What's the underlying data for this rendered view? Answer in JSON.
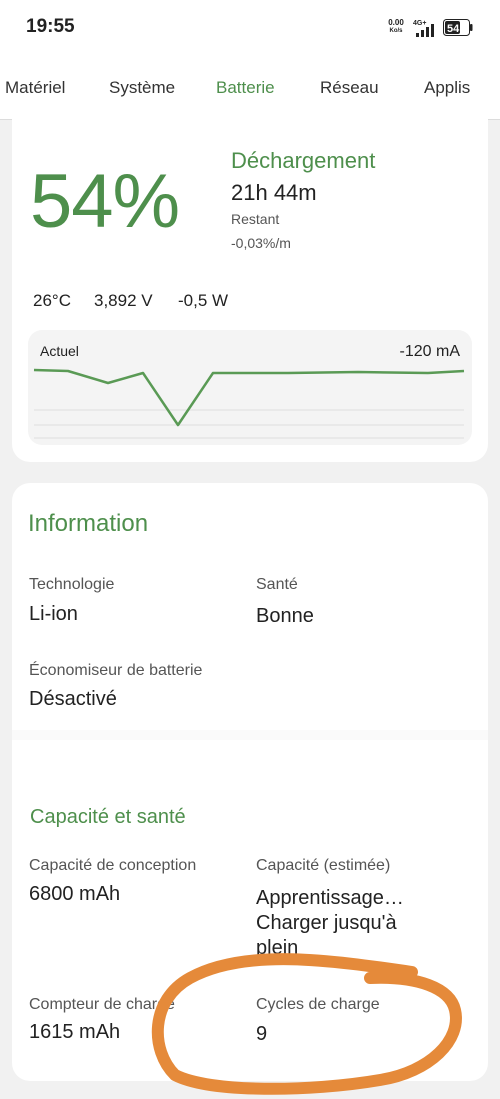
{
  "status_bar": {
    "time": "19:55",
    "net_speed_value": "0.00",
    "net_speed_unit": "Ko/s",
    "network_type": "4G+",
    "battery_level": "54"
  },
  "tabs": [
    {
      "label": "Matériel",
      "active": false
    },
    {
      "label": "Système",
      "active": false
    },
    {
      "label": "Batterie",
      "active": true
    },
    {
      "label": "Réseau",
      "active": false
    },
    {
      "label": "Applis",
      "active": false
    }
  ],
  "battery": {
    "percent": "54%",
    "state": "Déchargement",
    "remaining_time": "21h 44m",
    "remaining_label": "Restant",
    "rate": "-0,03%/m",
    "temperature": "26°C",
    "voltage": "3,892 V",
    "power": "-0,5 W",
    "graph_label": "Actuel",
    "graph_value": "-120 mA"
  },
  "information": {
    "title": "Information",
    "technology_label": "Technologie",
    "technology_value": "Li-ion",
    "health_label": "Santé",
    "health_value": "Bonne",
    "saver_label": "Économiseur de batterie",
    "saver_value": "Désactivé"
  },
  "capacity": {
    "title": "Capacité et santé",
    "design_label": "Capacité de conception",
    "design_value": "6800 mAh",
    "estimated_label": "Capacité (estimée)",
    "estimated_value_line1": "Apprentissage…",
    "estimated_value_line2": "Charger jusqu'à",
    "estimated_value_line3": "plein",
    "counter_label": "Compteur de charge",
    "counter_value": "1615 mAh",
    "cycles_label": "Cycles de charge",
    "cycles_value": "9"
  },
  "colors": {
    "accent": "#4e8f4c",
    "annotation": "#e58a3a"
  }
}
